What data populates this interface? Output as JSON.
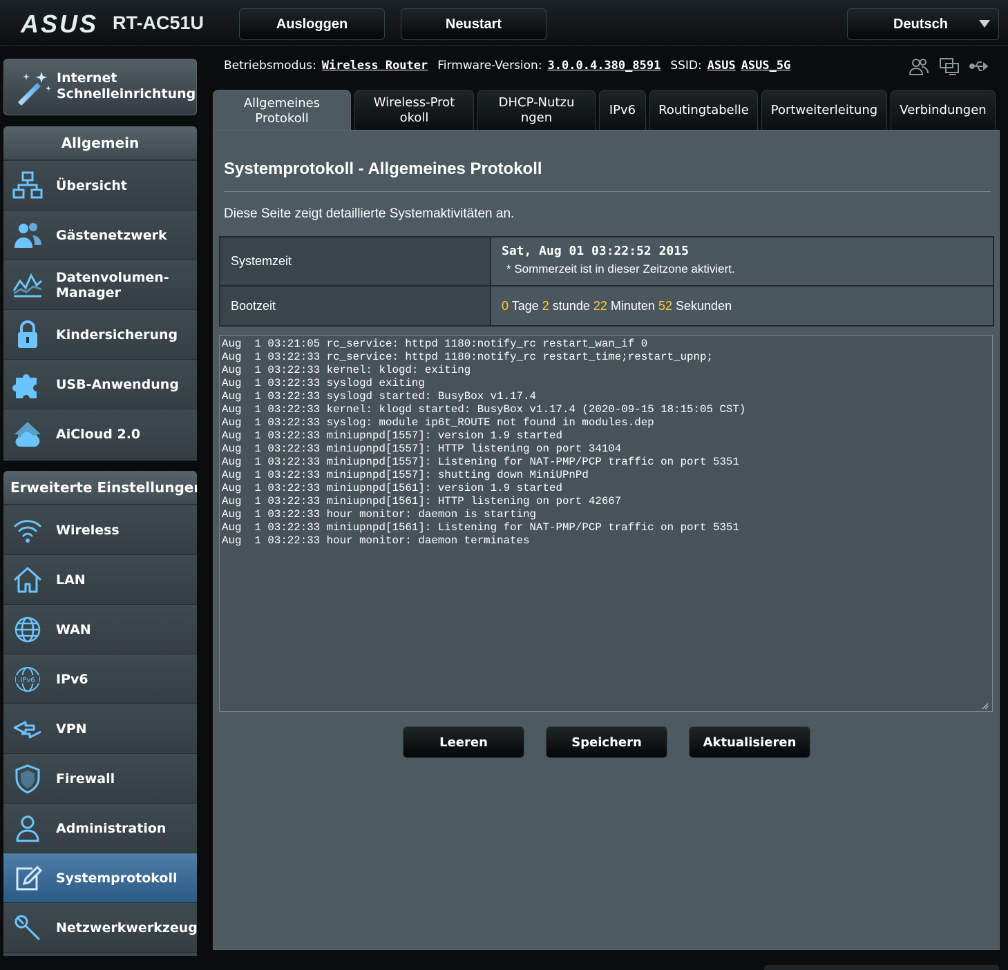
{
  "header": {
    "brand": "ASUS",
    "model": "RT-AC51U",
    "logout_label": "Ausloggen",
    "restart_label": "Neustart",
    "language": "Deutsch"
  },
  "status": {
    "mode_label": "Betriebsmodus:",
    "mode_value": "Wireless Router",
    "firmware_label": "Firmware-Version:",
    "firmware_value": "3.0.0.4.380_8591",
    "ssid_label": "SSID:",
    "ssid_24": "ASUS",
    "ssid_5": "ASUS_5G",
    "icons": [
      "clients-icon",
      "devices-icon",
      "usb-icon"
    ]
  },
  "sidebar": {
    "qis_label": "Internet Schnelleinrichtung",
    "general_title": "Allgemein",
    "general_items": [
      {
        "label": "Übersicht",
        "icon": "network-map-icon"
      },
      {
        "label": "Gästenetzwerk",
        "icon": "guest-network-icon"
      },
      {
        "label": "Datenvolumen-Manager",
        "icon": "traffic-manager-icon"
      },
      {
        "label": "Kindersicherung",
        "icon": "lock-icon"
      },
      {
        "label": "USB-Anwendung",
        "icon": "puzzle-icon"
      },
      {
        "label": "AiCloud 2.0",
        "icon": "cloud-icon"
      }
    ],
    "advanced_title": "Erweiterte Einstellungen",
    "advanced_items": [
      {
        "label": "Wireless",
        "icon": "wifi-icon"
      },
      {
        "label": "LAN",
        "icon": "home-icon"
      },
      {
        "label": "WAN",
        "icon": "globe-icon"
      },
      {
        "label": "IPv6",
        "icon": "ipv6-globe-icon"
      },
      {
        "label": "VPN",
        "icon": "vpn-icon"
      },
      {
        "label": "Firewall",
        "icon": "shield-icon"
      },
      {
        "label": "Administration",
        "icon": "user-icon"
      },
      {
        "label": "Systemprotokoll",
        "icon": "edit-log-icon",
        "active": true
      },
      {
        "label": "Netzwerkwerkzeuge",
        "icon": "tools-icon"
      }
    ]
  },
  "tabs": [
    {
      "label": "Allgemeines Protokoll",
      "active": true
    },
    {
      "label": "Wireless-Protokoll"
    },
    {
      "label": "DHCP-Nutzungen"
    },
    {
      "label": "IPv6"
    },
    {
      "label": "Routingtabelle"
    },
    {
      "label": "Portweiterleitung"
    },
    {
      "label": "Verbindungen"
    }
  ],
  "main": {
    "title": "Systemprotokoll - Allgemeines Protokoll",
    "description": "Diese Seite zeigt detaillierte Systemaktivitäten an.",
    "system_time_label": "Systemzeit",
    "system_time_value": "Sat, Aug 01 03:22:52 2015",
    "dst_note": "* Sommerzeit ist in dieser Zeitzone aktiviert.",
    "boot_time_label": "Bootzeit",
    "boot_days": "0",
    "boot_days_unit": "Tage",
    "boot_hours": "2",
    "boot_hours_unit": "stunde",
    "boot_minutes": "22",
    "boot_minutes_unit": "Minuten",
    "boot_seconds": "52",
    "boot_seconds_unit": "Sekunden",
    "log_lines": [
      "Aug  1 03:21:05 rc_service: httpd 1180:notify_rc restart_wan_if 0",
      "Aug  1 03:22:33 rc_service: httpd 1180:notify_rc restart_time;restart_upnp;",
      "Aug  1 03:22:33 kernel: klogd: exiting",
      "Aug  1 03:22:33 syslogd exiting",
      "Aug  1 03:22:33 syslogd started: BusyBox v1.17.4",
      "Aug  1 03:22:33 kernel: klogd started: BusyBox v1.17.4 (2020-09-15 18:15:05 CST)",
      "Aug  1 03:22:33 syslog: module ip6t_ROUTE not found in modules.dep",
      "Aug  1 03:22:33 miniupnpd[1557]: version 1.9 started",
      "Aug  1 03:22:33 miniupnpd[1557]: HTTP listening on port 34104",
      "Aug  1 03:22:33 miniupnpd[1557]: Listening for NAT-PMP/PCP traffic on port 5351",
      "Aug  1 03:22:33 miniupnpd[1557]: shutting down MiniUPnPd",
      "Aug  1 03:22:33 miniupnpd[1561]: version 1.9 started",
      "Aug  1 03:22:33 miniupnpd[1561]: HTTP listening on port 42667",
      "Aug  1 03:22:33 hour monitor: daemon is starting",
      "Aug  1 03:22:33 miniupnpd[1561]: Listening for NAT-PMP/PCP traffic on port 5351",
      "Aug  1 03:22:33 hour monitor: daemon terminates"
    ],
    "clear_label": "Leeren",
    "save_label": "Speichern",
    "refresh_label": "Aktualisieren"
  },
  "colors": {
    "accent_number": "#ffcc33",
    "active_nav": "#3a6b96",
    "panel_bg": "#4d5a61"
  }
}
